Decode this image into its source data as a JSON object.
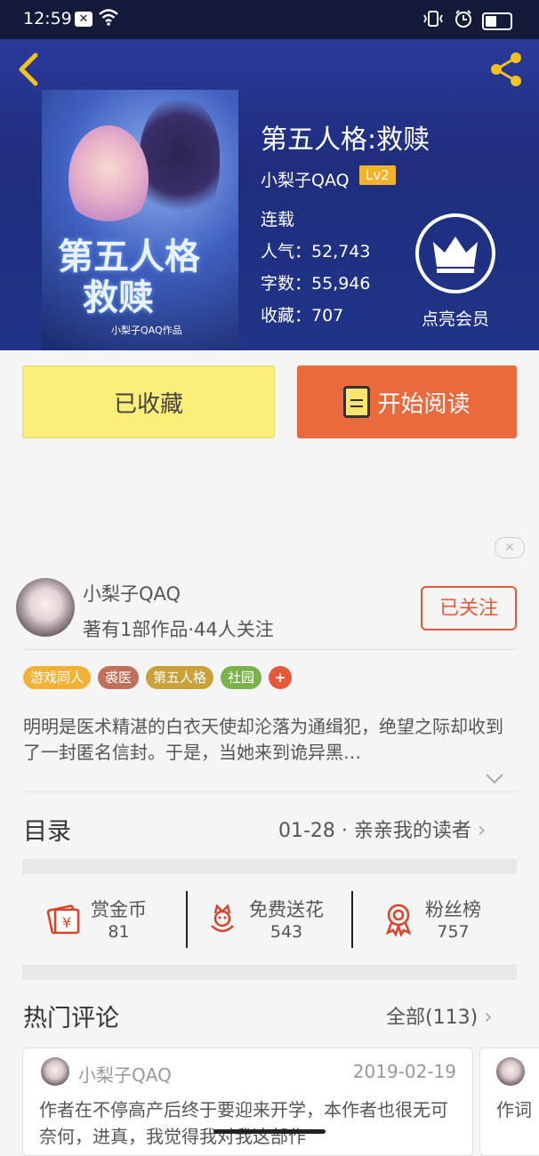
{
  "status_bar": {
    "time": "12:59",
    "badge": "✕",
    "wifi": "ᯤ",
    "right_icons": "⁰🔔"
  },
  "header": {
    "back_icon": "back-arrow",
    "share_icon": "share"
  },
  "book": {
    "cover_title": "第五人格救赎",
    "cover_author": "小梨子QAQ作品",
    "title": "第五人格:救赎",
    "author": "小梨子QAQ",
    "level": "Lv2",
    "status": "连载",
    "popularity": "人气：52,743",
    "words": "字数：55,946",
    "favorites": "收藏：707",
    "vip_label": "点亮会员"
  },
  "actions": {
    "collected": "已收藏",
    "start_reading": "开始阅读"
  },
  "author_card": {
    "name": "小梨子QAQ",
    "info": "著有1部作品·44人关注",
    "follow": "已关注"
  },
  "tags": [
    {
      "label": "游戏同人",
      "color": "#f2b23a"
    },
    {
      "label": "裘医",
      "color": "#c0705a"
    },
    {
      "label": "第五人格",
      "color": "#c9a23a"
    },
    {
      "label": "社园",
      "color": "#79b34a"
    },
    {
      "label": "+",
      "color": "#e65a3a"
    }
  ],
  "description": "明明是医术精湛的白衣天使却沦落为通缉犯，绝望之际却收到了一封匿名信封。于是，当她来到诡异黑…",
  "directory": {
    "title": "目录",
    "latest": "01-28 · 亲亲我的读者"
  },
  "stats": [
    {
      "label": "赏金币",
      "value": "81"
    },
    {
      "label": "免费送花",
      "value": "543"
    },
    {
      "label": "粉丝榜",
      "value": "757"
    }
  ],
  "comments": {
    "title": "热门评论",
    "all": "全部(113)",
    "items": [
      {
        "user": "小梨子QAQ",
        "date": "2019-02-19",
        "text": "作者在不停高产后终于要迎来开学，本作者也很无可奈何，进真，我觉得我对我这部作"
      },
      {
        "user": "",
        "date": "",
        "text": "作词"
      }
    ]
  },
  "colors": {
    "accent": "#ea6a3d",
    "hero": "#1f2e7e",
    "collect": "#fbef7a"
  }
}
